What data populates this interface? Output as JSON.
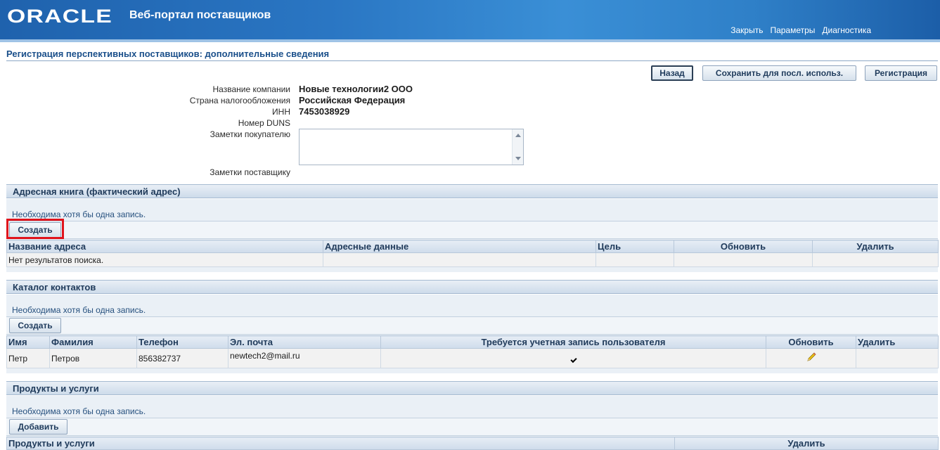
{
  "header": {
    "logo": "ORACLE",
    "title": "Веб-портал поставщиков",
    "links": [
      "Закрыть",
      "Параметры",
      "Диагностика"
    ]
  },
  "page_title": "Регистрация перспективных поставщиков: дополнительные сведения",
  "actions": {
    "back": "Назад",
    "save": "Сохранить для посл. использ.",
    "register": "Регистрация"
  },
  "form": {
    "company_label": "Название компании",
    "company_value": "Новые технологии2 ООО",
    "country_label": "Страна налогообложения",
    "country_value": "Российская Федерация",
    "inn_label": "ИНН",
    "inn_value": "7453038929",
    "duns_label": "Номер DUNS",
    "buyer_notes_label": "Заметки покупателю",
    "supplier_notes_label": "Заметки поставщику"
  },
  "address_book": {
    "title": "Адресная книга (фактический адрес)",
    "hint": "Необходима хотя бы одна запись.",
    "create": "Создать",
    "columns": [
      "Название адреса",
      "Адресные данные",
      "Цель",
      "Обновить",
      "Удалить"
    ],
    "empty": "Нет результатов поиска."
  },
  "contacts": {
    "title": "Каталог контактов",
    "hint": "Необходима хотя бы одна запись.",
    "create": "Создать",
    "columns": [
      "Имя",
      "Фамилия",
      "Телефон",
      "Эл. почта",
      "Требуется учетная запись пользователя",
      "Обновить",
      "Удалить"
    ],
    "rows": [
      {
        "first": "Петр",
        "last": "Петров",
        "phone": "856382737",
        "email": "newtech2@mail.ru",
        "account_required": true
      }
    ]
  },
  "products": {
    "title": "Продукты и услуги",
    "hint": "Необходима хотя бы одна запись.",
    "add": "Добавить",
    "columns": [
      "Продукты и услуги",
      "Удалить"
    ]
  },
  "colors": {
    "header_blue": "#2a76c3",
    "highlight_red": "#e0141c"
  }
}
